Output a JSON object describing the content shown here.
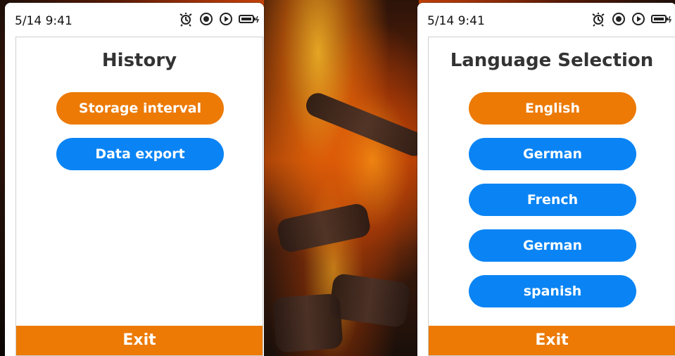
{
  "left_screen": {
    "status_time": "5/14 9:41",
    "title": "History",
    "buttons": [
      {
        "label": "Storage interval",
        "color": "#ec7a05"
      },
      {
        "label": "Data export",
        "color": "#0a84f4"
      }
    ],
    "exit_label": "Exit"
  },
  "right_screen": {
    "status_time": "5/14 9:41",
    "title": "Language Selection",
    "buttons": [
      {
        "label": "English",
        "color": "#ec7a05"
      },
      {
        "label": "German",
        "color": "#0a84f4"
      },
      {
        "label": "French",
        "color": "#0a84f4"
      },
      {
        "label": "German",
        "color": "#0a84f4"
      },
      {
        "label": "spanish",
        "color": "#0a84f4"
      }
    ],
    "exit_label": "Exit"
  },
  "status_icons": [
    "alarm-icon",
    "record-icon",
    "play-icon",
    "battery-icon"
  ],
  "colors": {
    "accent_orange": "#ec7a05",
    "accent_blue": "#0a84f4",
    "title_text": "#333333"
  }
}
